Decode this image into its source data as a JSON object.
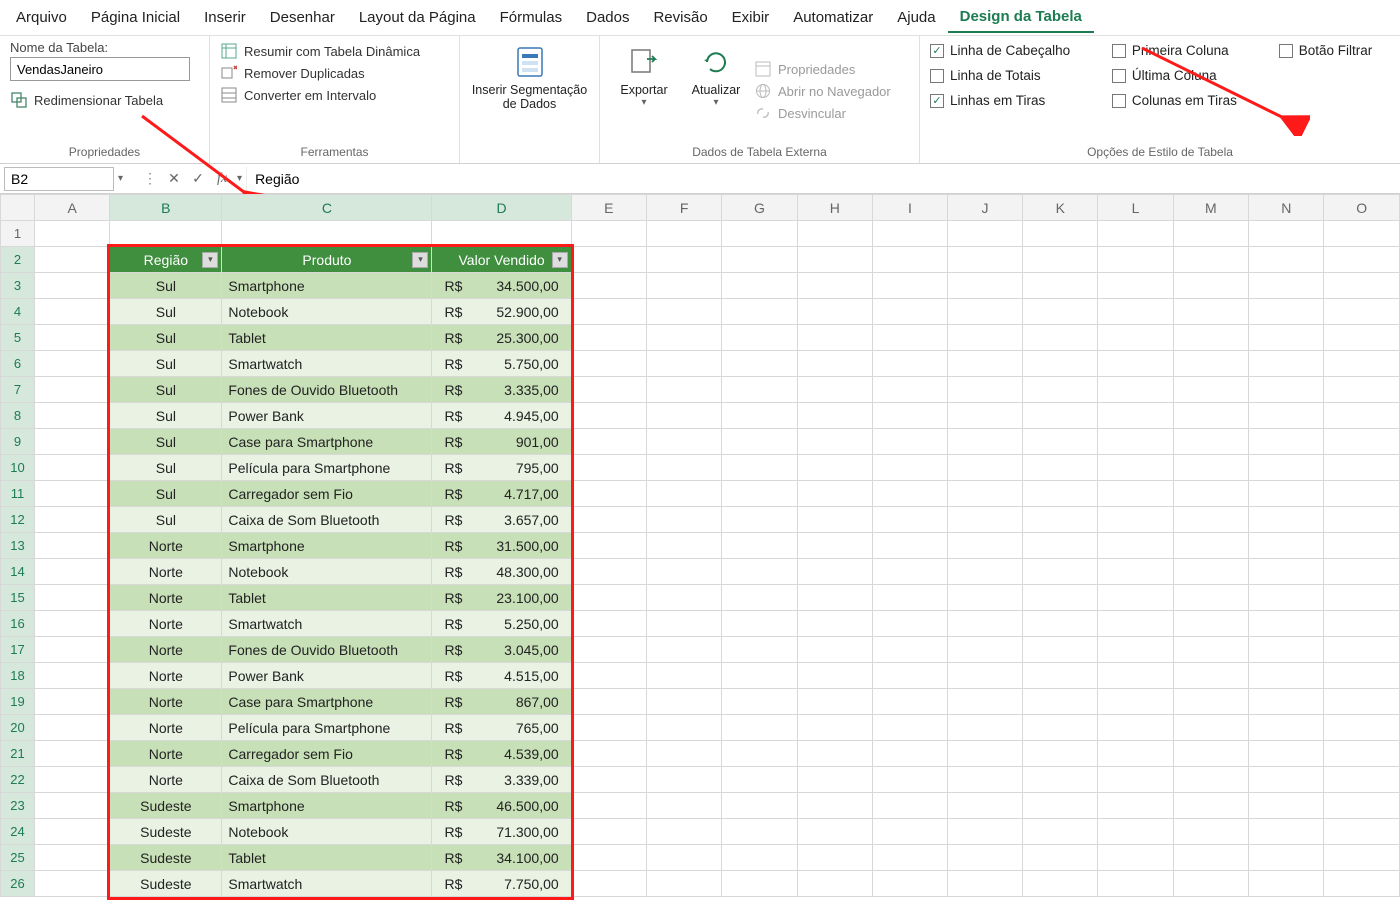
{
  "menubar": {
    "items": [
      "Arquivo",
      "Página Inicial",
      "Inserir",
      "Desenhar",
      "Layout da Página",
      "Fórmulas",
      "Dados",
      "Revisão",
      "Exibir",
      "Automatizar",
      "Ajuda",
      "Design da Tabela"
    ],
    "active_index": 11
  },
  "ribbon": {
    "properties": {
      "label_table_name": "Nome da Tabela:",
      "table_name_value": "VendasJaneiro",
      "resize_label": "Redimensionar Tabela",
      "group_title": "Propriedades"
    },
    "tools": {
      "summarize": "Resumir com Tabela Dinâmica",
      "remove_dup": "Remover Duplicadas",
      "convert_range": "Converter em Intervalo",
      "group_title": "Ferramentas"
    },
    "slicer": {
      "label_line1": "Inserir Segmentação",
      "label_line2": "de Dados"
    },
    "external": {
      "export": "Exportar",
      "refresh": "Atualizar",
      "props": "Propriedades",
      "open_browser": "Abrir no Navegador",
      "unlink": "Desvincular",
      "group_title": "Dados de Tabela Externa"
    },
    "styleopts": {
      "header_row": "Linha de Cabeçalho",
      "total_row": "Linha de Totais",
      "banded_rows": "Linhas em Tiras",
      "first_col": "Primeira Coluna",
      "last_col": "Última Coluna",
      "banded_cols": "Colunas em Tiras",
      "filter_btn": "Botão Filtrar",
      "group_title": "Opções de Estilo de Tabela",
      "checked": {
        "header_row": true,
        "total_row": false,
        "banded_rows": true,
        "first_col": false,
        "last_col": false,
        "banded_cols": false,
        "filter_btn": false
      }
    }
  },
  "formula_bar": {
    "name_box": "B2",
    "formula_value": "Região"
  },
  "grid": {
    "col_letters": [
      "A",
      "B",
      "C",
      "D",
      "E",
      "F",
      "G",
      "H",
      "I",
      "J",
      "K",
      "L",
      "M",
      "N",
      "O"
    ],
    "selected_cols": [
      "B",
      "C",
      "D"
    ],
    "table_headers": [
      "Região",
      "Produto",
      "Valor Vendido"
    ],
    "currency_prefix": "R$",
    "rows": [
      {
        "regiao": "Sul",
        "produto": "Smartphone",
        "valor": "34.500,00"
      },
      {
        "regiao": "Sul",
        "produto": "Notebook",
        "valor": "52.900,00"
      },
      {
        "regiao": "Sul",
        "produto": "Tablet",
        "valor": "25.300,00"
      },
      {
        "regiao": "Sul",
        "produto": "Smartwatch",
        "valor": "5.750,00"
      },
      {
        "regiao": "Sul",
        "produto": "Fones de Ouvido Bluetooth",
        "valor": "3.335,00"
      },
      {
        "regiao": "Sul",
        "produto": "Power Bank",
        "valor": "4.945,00"
      },
      {
        "regiao": "Sul",
        "produto": "Case para Smartphone",
        "valor": "901,00"
      },
      {
        "regiao": "Sul",
        "produto": "Película para Smartphone",
        "valor": "795,00"
      },
      {
        "regiao": "Sul",
        "produto": "Carregador sem Fio",
        "valor": "4.717,00"
      },
      {
        "regiao": "Sul",
        "produto": "Caixa de Som Bluetooth",
        "valor": "3.657,00"
      },
      {
        "regiao": "Norte",
        "produto": "Smartphone",
        "valor": "31.500,00"
      },
      {
        "regiao": "Norte",
        "produto": "Notebook",
        "valor": "48.300,00"
      },
      {
        "regiao": "Norte",
        "produto": "Tablet",
        "valor": "23.100,00"
      },
      {
        "regiao": "Norte",
        "produto": "Smartwatch",
        "valor": "5.250,00"
      },
      {
        "regiao": "Norte",
        "produto": "Fones de Ouvido Bluetooth",
        "valor": "3.045,00"
      },
      {
        "regiao": "Norte",
        "produto": "Power Bank",
        "valor": "4.515,00"
      },
      {
        "regiao": "Norte",
        "produto": "Case para Smartphone",
        "valor": "867,00"
      },
      {
        "regiao": "Norte",
        "produto": "Película para Smartphone",
        "valor": "765,00"
      },
      {
        "regiao": "Norte",
        "produto": "Carregador sem Fio",
        "valor": "4.539,00"
      },
      {
        "regiao": "Norte",
        "produto": "Caixa de Som Bluetooth",
        "valor": "3.339,00"
      },
      {
        "regiao": "Sudeste",
        "produto": "Smartphone",
        "valor": "46.500,00"
      },
      {
        "regiao": "Sudeste",
        "produto": "Notebook",
        "valor": "71.300,00"
      },
      {
        "regiao": "Sudeste",
        "produto": "Tablet",
        "valor": "34.100,00"
      },
      {
        "regiao": "Sudeste",
        "produto": "Smartwatch",
        "valor": "7.750,00"
      }
    ],
    "visible_row_count": 25
  }
}
